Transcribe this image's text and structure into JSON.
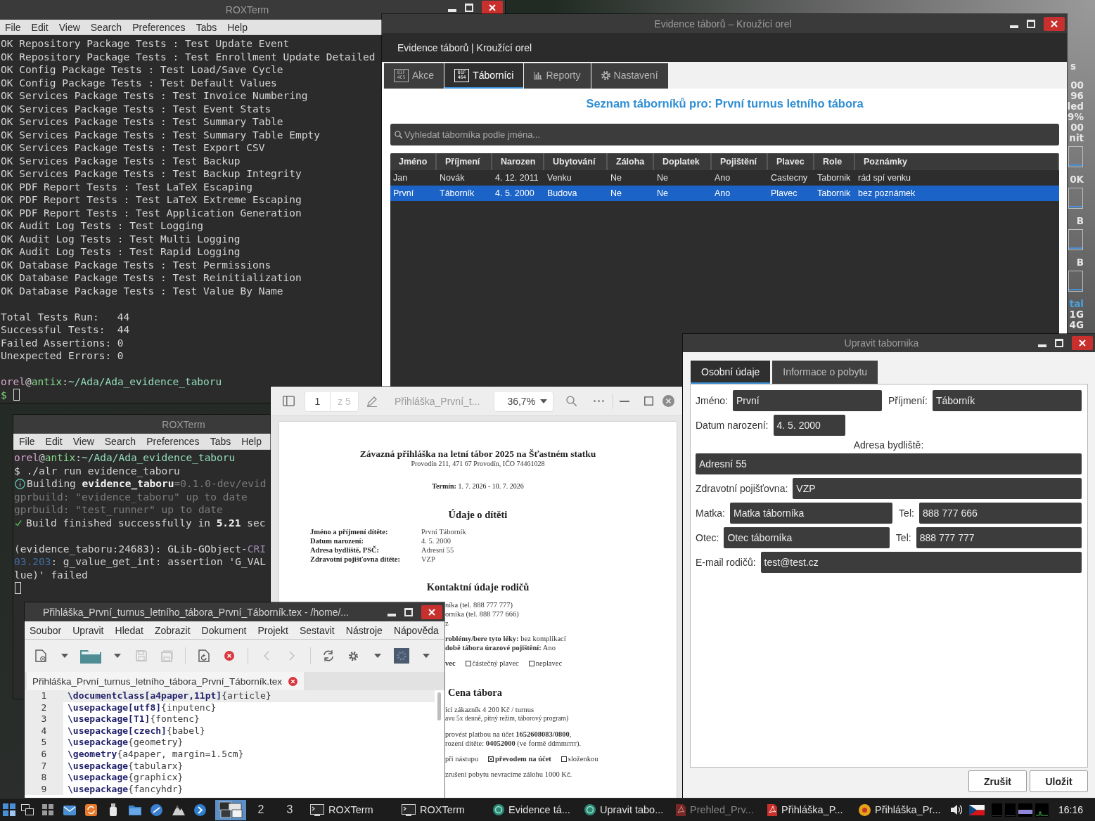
{
  "desktop": {
    "conky": [
      {
        "kind": "title",
        "text": "s"
      },
      {
        "kind": "text",
        "text": "00"
      },
      {
        "kind": "text",
        "text": "96"
      },
      {
        "kind": "text",
        "text": "led"
      },
      {
        "kind": "text",
        "text": "9%"
      },
      {
        "kind": "text",
        "text": "00"
      },
      {
        "kind": "text",
        "text": "nit"
      },
      {
        "kind": "graph"
      },
      {
        "kind": "text",
        "text": "0K"
      },
      {
        "kind": "graph"
      },
      {
        "kind": "text",
        "text": "B"
      },
      {
        "kind": "graph"
      },
      {
        "kind": "text",
        "text": "B"
      },
      {
        "kind": "graph"
      },
      {
        "kind": "heading",
        "text": "tal"
      },
      {
        "kind": "text",
        "text": "1G"
      },
      {
        "kind": "text",
        "text": "4G"
      }
    ]
  },
  "terminal_top": {
    "title": "ROXTerm",
    "menu": [
      "File",
      "Edit",
      "View",
      "Search",
      "Preferences",
      "Tabs",
      "Help"
    ],
    "blocks": [
      [
        {
          "kind": "output",
          "text": "OK Repository Package Tests : Test Update Event"
        },
        {
          "kind": "output",
          "text": "OK Repository Package Tests : Test Enrollment Update Detailed"
        },
        {
          "kind": "output",
          "text": "OK Config Package Tests : Test Load/Save Cycle"
        },
        {
          "kind": "output",
          "text": "OK Config Package Tests : Test Default Values"
        },
        {
          "kind": "output",
          "text": "OK Services Package Tests : Test Invoice Numbering"
        },
        {
          "kind": "output",
          "text": "OK Services Package Tests : Test Event Stats"
        },
        {
          "kind": "output",
          "text": "OK Services Package Tests : Test Summary Table"
        },
        {
          "kind": "output",
          "text": "OK Services Package Tests : Test Summary Table Empty"
        },
        {
          "kind": "output",
          "text": "OK Services Package Tests : Test Export CSV"
        },
        {
          "kind": "output",
          "text": "OK Services Package Tests : Test Backup"
        },
        {
          "kind": "output",
          "text": "OK Services Package Tests : Test Backup Integrity"
        },
        {
          "kind": "output",
          "text": "OK PDF Report Tests : Test LaTeX Escaping"
        },
        {
          "kind": "output",
          "text": "OK PDF Report Tests : Test LaTeX Extreme Escaping"
        },
        {
          "kind": "output",
          "text": "OK PDF Report Tests : Test Application Generation"
        },
        {
          "kind": "output",
          "text": "OK Audit Log Tests : Test Logging"
        },
        {
          "kind": "output",
          "text": "OK Audit Log Tests : Test Multi Logging"
        },
        {
          "kind": "output",
          "text": "OK Audit Log Tests : Test Rapid Logging"
        },
        {
          "kind": "output",
          "text": "OK Database Package Tests : Test Permissions"
        },
        {
          "kind": "output",
          "text": "OK Database Package Tests : Test Reinitialization"
        },
        {
          "kind": "output",
          "text": "OK Database Package Tests : Test Value By Name"
        }
      ],
      [
        {
          "kind": "output",
          "text": "Total Tests Run:   44"
        },
        {
          "kind": "output",
          "text": "Successful Tests:  44"
        },
        {
          "kind": "output",
          "text": "Failed Assertions: 0"
        },
        {
          "kind": "output",
          "text": "Unexpected Errors: 0"
        }
      ],
      [
        {
          "kind": "output",
          "segments": [
            {
              "kind": "user",
              "text": "orel"
            },
            {
              "kind": "plain",
              "text": "@"
            },
            {
              "kind": "host",
              "text": "antix"
            },
            {
              "kind": "plain",
              "text": ":"
            },
            {
              "kind": "path",
              "text": "~/Ada/Ada_evidence_taboru"
            }
          ]
        },
        {
          "kind": "input",
          "segments": [
            {
              "kind": "sign",
              "text": "$"
            }
          ]
        }
      ]
    ]
  },
  "main_window": {
    "title": "Evidence táborů – Kroužící orel",
    "header": "Evidence táborů | Kroužící orel",
    "tabs": [
      {
        "label": "Akce",
        "kind": "glyph",
        "glyph": [
          "01F",
          "4C5"
        ],
        "selected": false
      },
      {
        "label": "Táborníci",
        "kind": "glyph",
        "glyph": [
          "01F",
          "464"
        ],
        "selected": true
      },
      {
        "label": "Reporty",
        "kind": "chart",
        "selected": false
      },
      {
        "label": "Nastavení",
        "kind": "gear",
        "selected": false
      }
    ],
    "heading": "Seznam táborníků pro: První turnus letního tábora",
    "search": {
      "placeholder": "Vyhledat táborníka podle jména..."
    },
    "table": {
      "columns": [
        "Jméno",
        "Příjmení",
        "Narozen",
        "Ubytování",
        "Záloha",
        "Doplatek",
        "Pojištění",
        "Plavec",
        "Role",
        "Poznámky"
      ],
      "rows": [
        {
          "selected": false,
          "cells": [
            "Jan",
            "Novák",
            "4. 12. 2011",
            "Venku",
            "Ne",
            "Ne",
            "Ano",
            "Castecny",
            "Tabornik",
            "rád spí venku"
          ]
        },
        {
          "selected": true,
          "cells": [
            "První",
            "Táborník",
            "4. 5. 2000",
            "Budova",
            "Ne",
            "Ne",
            "Ano",
            "Plavec",
            "Tabornik",
            "bez poznámek"
          ]
        }
      ]
    }
  },
  "terminal_bottom": {
    "title": "ROXTerm",
    "menu": [
      "File",
      "Edit",
      "View",
      "Search",
      "Preferences",
      "Tabs",
      "Help"
    ],
    "blocks": [
      [
        {
          "kind": "output",
          "segments": [
            {
              "kind": "user",
              "text": "orel"
            },
            {
              "kind": "plain",
              "text": "@"
            },
            {
              "kind": "host",
              "text": "antix"
            },
            {
              "kind": "plain",
              "text": ":"
            },
            {
              "kind": "path",
              "text": "~/Ada/Ada_evidence_taboru"
            }
          ]
        },
        {
          "kind": "output",
          "text": "$ ./alr run evidence_taboru"
        },
        {
          "kind": "info",
          "segments": [
            {
              "kind": "plain",
              "text": "Building "
            },
            {
              "kind": "bold",
              "text": "evidence_taboru"
            },
            {
              "kind": "dim",
              "text": "=0.1.0-dev/evid"
            }
          ]
        },
        {
          "kind": "output",
          "segments": [
            {
              "kind": "dim",
              "text": "gprbuild: \"evidence_taboru\" up to date"
            }
          ]
        },
        {
          "kind": "output",
          "segments": [
            {
              "kind": "dim",
              "text": "gprbuild: \"test_runner\" up to date"
            }
          ]
        },
        {
          "kind": "success",
          "segments": [
            {
              "kind": "plain",
              "text": "Build finished successfully in "
            },
            {
              "kind": "bold",
              "text": "5.21"
            },
            {
              "kind": "plain",
              "text": " sec"
            }
          ]
        }
      ],
      [
        {
          "kind": "output",
          "segments": [
            {
              "kind": "plain",
              "text": "(evidence_taboru:24683): GLib-GObject-"
            },
            {
              "kind": "crit",
              "text": "CRI"
            }
          ]
        },
        {
          "kind": "output",
          "segments": [
            {
              "kind": "time",
              "text": "03.203"
            },
            {
              "kind": "plain",
              "text": ": g_value_get_int: assertion 'G_VAL"
            }
          ]
        },
        {
          "kind": "output",
          "text": "lue)' failed"
        },
        {
          "kind": "input"
        }
      ]
    ]
  },
  "pdf_viewer": {
    "page": "1",
    "page_total": "z 5",
    "title": "Přihláška_První_t...",
    "zoom": "36,7%",
    "document": {
      "title": "Závazná přihláška na letní tábor 2025 na Šťastném statku",
      "subtitle": "Provodín 211, 471 67 Provodín, IČO 74461028",
      "term": "**Termín:** 1. 7. 2026 - 10. 7. 2026",
      "child_heading": "Údaje o dítěti",
      "child_fields": [
        {
          "label": "Jméno a příjmení dítěte:",
          "value": "První Táborník"
        },
        {
          "label": "Datum narození:",
          "value": "4. 5. 2000"
        },
        {
          "label": "Adresa bydliště, PSČ:",
          "value": "Adresní 55"
        },
        {
          "label": "Zdravotní pojišťovna dítěte:",
          "value": "VZP"
        }
      ],
      "parents_heading": "Kontaktní údaje rodičů",
      "paragraphs": [
        [
          {
            "kind": "text",
            "text": "níka (tel. 888 777 777)"
          },
          {
            "kind": "text",
            "text": "orníka (tel. 888 777 666)"
          },
          {
            "kind": "text",
            "text": "z"
          }
        ],
        [
          {
            "kind": "text",
            "text": "**roblémy/bere tyto léky:** bez komplikací"
          },
          {
            "kind": "text",
            "text": "**době tábora úrazové pojištění:** Ano"
          }
        ],
        [
          {
            "kind": "checks",
            "options": [
              {
                "kind": "cut",
                "label": "vec",
                "checked": true
              },
              {
                "kind": "box",
                "label": "částečný plavec",
                "checked": false
              },
              {
                "kind": "box",
                "label": "neplavec",
                "checked": false
              }
            ]
          }
        ],
        [
          {
            "kind": "heading",
            "text": "Cena tábora"
          }
        ],
        [
          {
            "kind": "text",
            "text": "ící zákazník 4 200 Kč / turnus"
          },
          {
            "kind": "small",
            "text": "avu 5x denně, pitný režim, táborový program)"
          }
        ],
        [
          {
            "kind": "text",
            "text": "provést platbou na účet **1652608083/0800**,"
          },
          {
            "kind": "text",
            "text": "rození dítěte: **04052000** (ve formě ddmmrrrr)."
          }
        ],
        [
          {
            "kind": "checks",
            "options": [
              {
                "kind": "cut",
                "label": "při nástupu",
                "checked": false
              },
              {
                "kind": "box",
                "label": "převodem na účet",
                "checked": true
              },
              {
                "kind": "box",
                "label": "složenkou",
                "checked": false
              }
            ]
          }
        ],
        [
          {
            "kind": "text",
            "text": "zrušení pobytu nevracíme zálohu 1000 Kč."
          }
        ]
      ]
    }
  },
  "editor": {
    "title": "Přihláška_První_turnus_letního_tábora_První_Táborník.tex - /home/...",
    "menu": [
      "Soubor",
      "Upravit",
      "Hledat",
      "Zobrazit",
      "Dokument",
      "Projekt",
      "Sestavit",
      "Nástroje",
      "Nápověda"
    ],
    "toolbar": [
      [
        {
          "kind": "new",
          "disabled": false
        },
        {
          "kind": "dropdown",
          "disabled": false
        },
        {
          "kind": "open",
          "disabled": false
        },
        {
          "kind": "dropdown",
          "disabled": false
        },
        {
          "kind": "save",
          "disabled": true
        },
        {
          "kind": "save-all",
          "disabled": true
        }
      ],
      [
        {
          "kind": "revert",
          "disabled": false
        },
        {
          "kind": "close",
          "disabled": false
        }
      ],
      [
        {
          "kind": "back",
          "disabled": true
        },
        {
          "kind": "forward",
          "disabled": true
        }
      ],
      [
        {
          "kind": "reload",
          "disabled": false
        },
        {
          "kind": "preferences",
          "disabled": false
        },
        {
          "kind": "dropdown",
          "disabled": false
        },
        {
          "kind": "color",
          "disabled": false
        },
        {
          "kind": "dropdown",
          "disabled": false
        }
      ]
    ],
    "tab": {
      "label": "Přihláška_První_turnus_letního_tábora_První_Táborník.tex"
    },
    "lines": [
      {
        "number": "1",
        "code": "**\\documentclass[a4paper,11pt]**{article}",
        "current": true
      },
      {
        "number": "2",
        "code": "**\\usepackage[utf8]**{inputenc}",
        "current": false
      },
      {
        "number": "3",
        "code": "**\\usepackage[T1]**{fontenc}",
        "current": false
      },
      {
        "number": "4",
        "code": "**\\usepackage[czech]**{babel}",
        "current": false
      },
      {
        "number": "5",
        "code": "**\\usepackage**{geometry}",
        "current": false
      },
      {
        "number": "6",
        "code": "**\\geometry**{a4paper, margin=1.5cm}",
        "current": false
      },
      {
        "number": "7",
        "code": "**\\usepackage**{tabularx}",
        "current": false
      },
      {
        "number": "8",
        "code": "**\\usepackage**{graphicx}",
        "current": false
      },
      {
        "number": "9",
        "code": "**\\usepackage**{fancyhdr}",
        "current": false
      }
    ]
  },
  "dialog": {
    "title": "Upravit tabornika",
    "tabs": [
      {
        "label": "Osobní údaje",
        "selected": true
      },
      {
        "label": "Informace o pobytu",
        "selected": false
      }
    ],
    "rows": [
      {
        "kind": "fields",
        "fields": [
          {
            "label": "Jméno:",
            "value": "První"
          },
          {
            "label": "Příjmení:",
            "value": "Táborník"
          }
        ]
      },
      {
        "kind": "short",
        "fields": [
          {
            "label": "Datum narození:",
            "value": "4. 5. 2000"
          }
        ]
      },
      {
        "kind": "caption",
        "text": "Adresa bydliště:"
      },
      {
        "kind": "fields",
        "fields": [
          {
            "value": "Adresní 55"
          }
        ]
      },
      {
        "kind": "fields",
        "fields": [
          {
            "label": "Zdravotní pojišťovna:",
            "value": "VZP"
          }
        ]
      },
      {
        "kind": "fields",
        "fields": [
          {
            "label": "Matka:",
            "value": "Matka táborníka"
          },
          {
            "label": "Tel:",
            "value": "888 777 666"
          }
        ]
      },
      {
        "kind": "fields",
        "fields": [
          {
            "label": "Otec:",
            "value": "Otec táborníka"
          },
          {
            "label": "Tel:",
            "value": "888 777 777"
          }
        ]
      },
      {
        "kind": "fields",
        "fields": [
          {
            "label": "E-mail rodičů:",
            "value": "test@test.cz"
          }
        ]
      }
    ],
    "buttons": [
      "Zrušit",
      "Uložit"
    ]
  },
  "taskbar": {
    "workspaces": [
      {
        "selected": true
      },
      {
        "label": "2",
        "selected": false
      },
      {
        "label": "3",
        "selected": false
      }
    ],
    "tasks": [
      {
        "kind": "terminal",
        "label": "ROXTerm",
        "minimized": false
      },
      {
        "kind": "terminal",
        "label": "ROXTerm",
        "minimized": false
      },
      {
        "kind": "app",
        "label": "Evidence tá...",
        "minimized": false
      },
      {
        "kind": "app",
        "label": "Upravit tabo...",
        "minimized": false
      },
      {
        "kind": "pdf",
        "label": "Prehled_Prv...",
        "minimized": true
      },
      {
        "kind": "pdf",
        "label": "Přihláška_P...",
        "minimized": false
      },
      {
        "kind": "viewer",
        "label": "Přihláška_Pr...",
        "minimized": false
      }
    ],
    "clock": "16:16"
  }
}
